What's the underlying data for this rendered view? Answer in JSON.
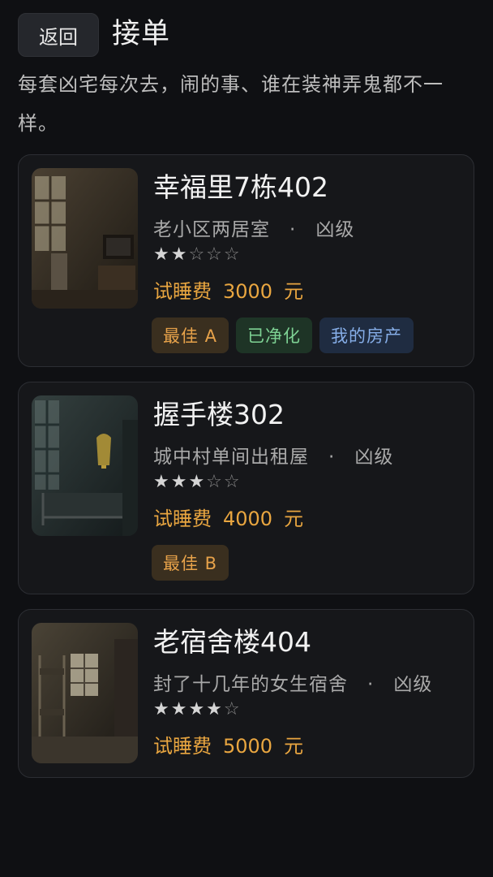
{
  "header": {
    "back_label": "返回",
    "title": "接单"
  },
  "intro": "每套凶宅每次去，闹的事、谁在装神弄鬼都不一样。",
  "orders": [
    {
      "title": "幸福里7栋402",
      "type": "老小区两居室",
      "separator": "·",
      "level_label": "凶级",
      "stars_on": "★★",
      "stars_off": "☆☆☆",
      "rating": 2,
      "fee_label": "试睡费",
      "fee_value": "3000",
      "fee_unit": "元",
      "tags": {
        "best": "最佳 A",
        "clean": "已净化",
        "mine": "我的房产"
      },
      "thumb_icon": "abandoned-room-tv-image"
    },
    {
      "title": "握手楼302",
      "type": "城中村单间出租屋",
      "separator": "·",
      "level_label": "凶级",
      "stars_on": "★★★",
      "stars_off": "☆☆",
      "rating": 3,
      "fee_label": "试睡费",
      "fee_value": "4000",
      "fee_unit": "元",
      "tags": {
        "best": "最佳 B"
      },
      "thumb_icon": "rusty-bed-room-image"
    },
    {
      "title": "老宿舍楼404",
      "type": "封了十几年的女生宿舍",
      "separator": "·",
      "level_label": "凶级",
      "stars_on": "★★★★",
      "stars_off": "☆",
      "rating": 4,
      "fee_label": "试睡费",
      "fee_value": "5000",
      "fee_unit": "元",
      "thumb_icon": "dormitory-bunk-image"
    }
  ],
  "colors": {
    "accent_fee": "#e9a640",
    "tag_best": "#e7a24a",
    "tag_clean": "#7ed294",
    "tag_mine": "#86aee8"
  }
}
